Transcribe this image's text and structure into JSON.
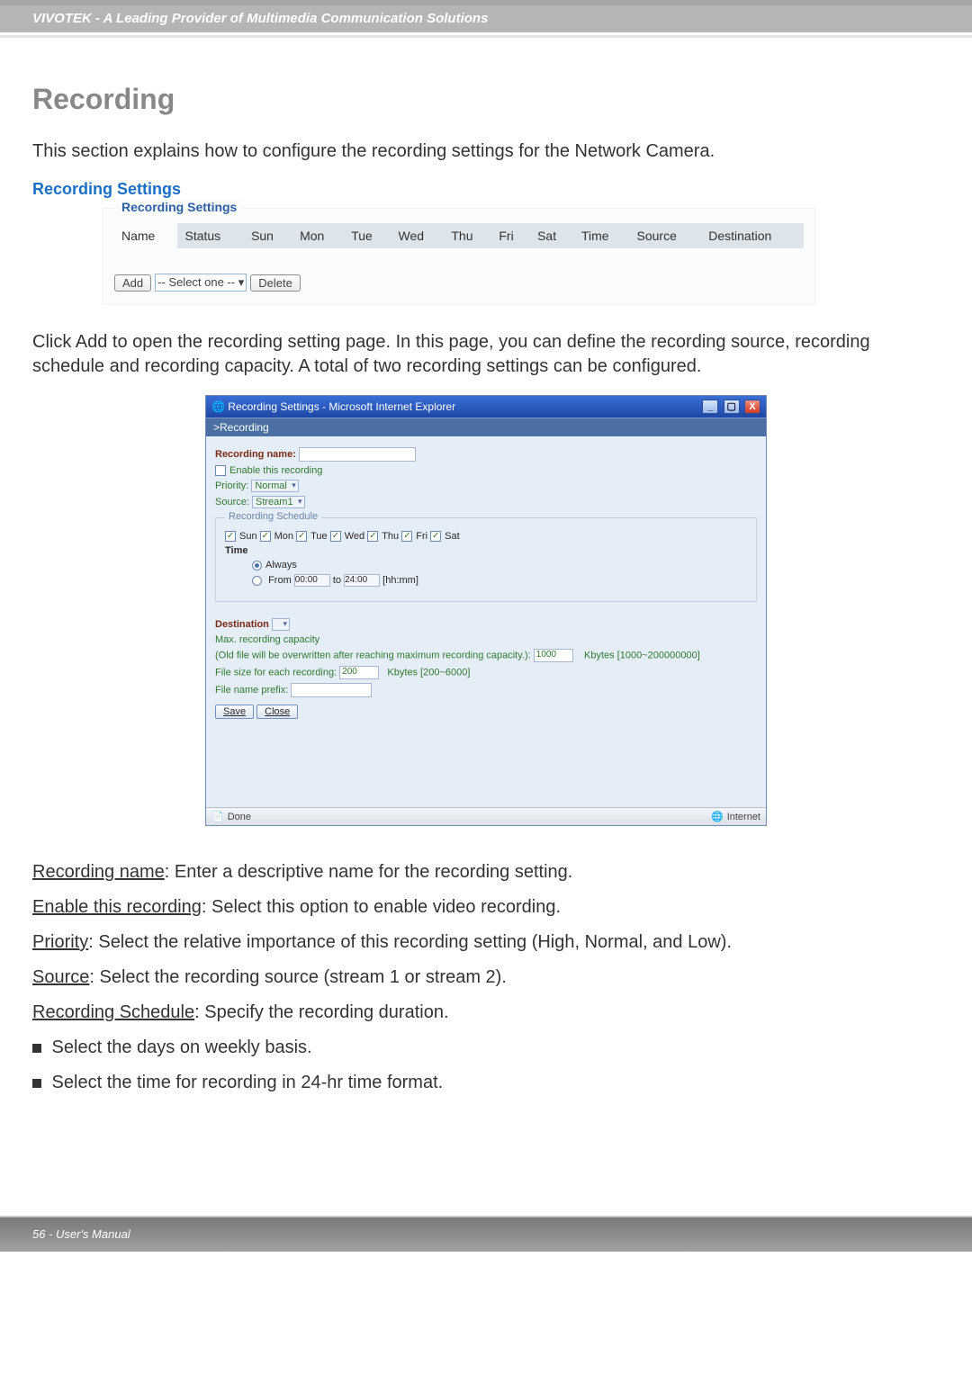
{
  "header": {
    "brand": "VIVOTEK - A Leading Provider of Multimedia Communication Solutions"
  },
  "title": "Recording",
  "intro": "This section explains how to configure the recording settings for the Network Camera.",
  "sub_heading": "Recording Settings",
  "settings_panel": {
    "legend": "Recording Settings",
    "columns": [
      "Name",
      "Status",
      "Sun",
      "Mon",
      "Tue",
      "Wed",
      "Thu",
      "Fri",
      "Sat",
      "Time",
      "Source",
      "Destination"
    ],
    "add_label": "Add",
    "select_placeholder": "-- Select one --",
    "delete_label": "Delete"
  },
  "add_hint": "Click Add to open the recording setting page. In this page, you can define the recording source, recording schedule and recording capacity. A total of two recording settings can be configured.",
  "dialog": {
    "title": "Recording Settings - Microsoft Internet Explorer",
    "breadcrumb": ">Recording",
    "rec_name_label": "Recording name:",
    "enable_label": "Enable this recording",
    "priority_label": "Priority:",
    "priority_value": "Normal",
    "source_label": "Source:",
    "source_value": "Stream1",
    "schedule_legend": "Recording Schedule",
    "days": [
      "Sun",
      "Mon",
      "Tue",
      "Wed",
      "Thu",
      "Fri",
      "Sat"
    ],
    "time_label": "Time",
    "always_label": "Always",
    "from_label": "From",
    "from_value": "00:00",
    "to_label": "to",
    "to_value": "24:00",
    "hhmm": "[hh:mm]",
    "dest_label": "Destination",
    "maxcap_label": "Max. recording capacity",
    "overwrite_note": "(Old file will be overwritten after reaching maximum recording capacity.):",
    "overwrite_value": "1000",
    "overwrite_range": "Kbytes [1000~200000000]",
    "filesize_label": "File size for each recording:",
    "filesize_value": "200",
    "filesize_range": "Kbytes [200~6000]",
    "prefix_label": "File name prefix:",
    "save": "Save",
    "close": "Close",
    "status_done": "Done",
    "status_net": "Internet"
  },
  "definitions": {
    "rec_name": {
      "t": "Recording name",
      "d": ": Enter a descriptive name for the recording setting."
    },
    "enable": {
      "t": "Enable this recording",
      "d": ": Select this option to enable video recording."
    },
    "priority": {
      "t": "Priority",
      "d": ": Select the relative importance of this recording setting (High, Normal, and Low)."
    },
    "source": {
      "t": "Source",
      "d": ": Select the recording source (stream 1 or stream 2)."
    },
    "schedule": {
      "t": "Recording Schedule",
      "d": ": Specify the recording duration."
    },
    "bullet1": " Select the days on weekly basis.",
    "bullet2": " Select the time for recording in 24-hr time format."
  },
  "footer": {
    "text": "56 - User's Manual"
  }
}
